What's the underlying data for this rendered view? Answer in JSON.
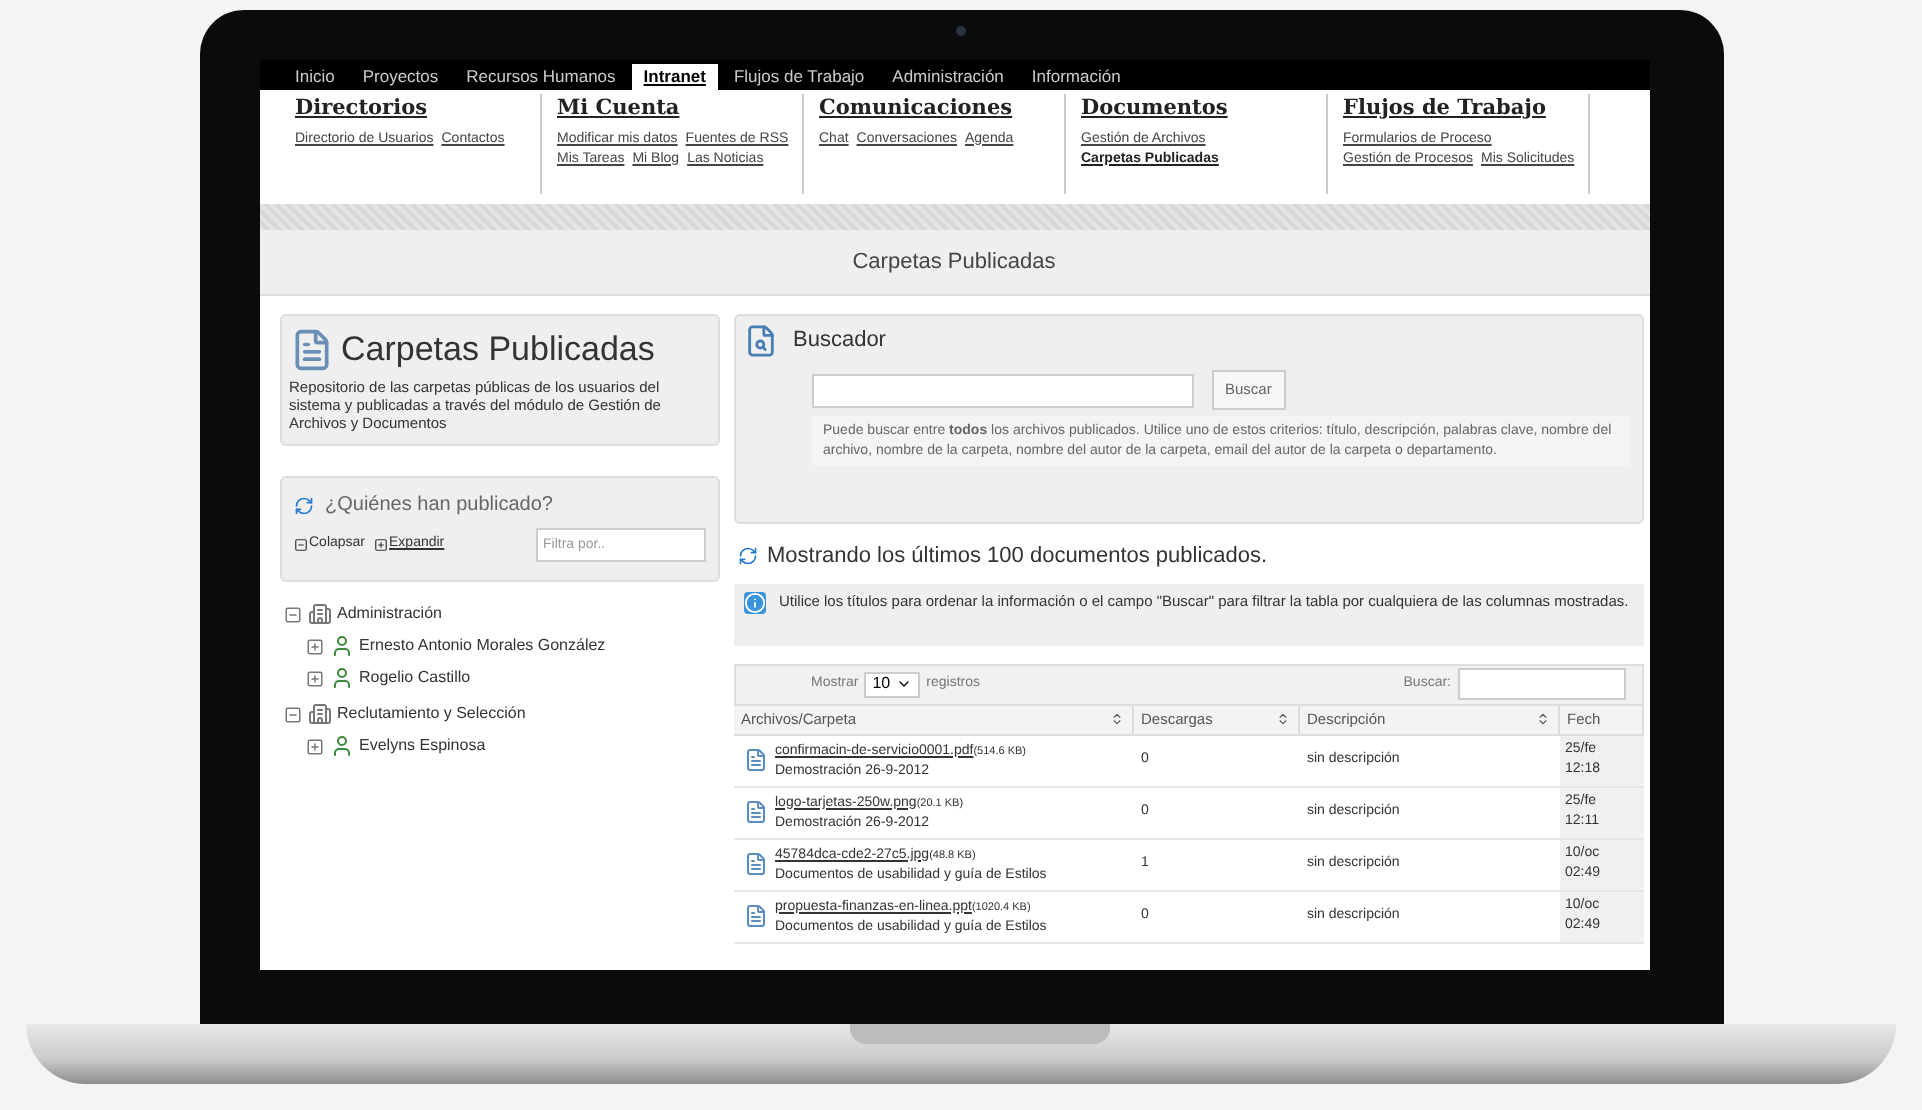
{
  "nav": [
    {
      "label": "Inicio",
      "selected": false
    },
    {
      "label": "Proyectos",
      "selected": false
    },
    {
      "label": "Recursos Humanos",
      "selected": false
    },
    {
      "label": "Intranet",
      "selected": true
    },
    {
      "label": "Flujos de Trabajo",
      "selected": false
    },
    {
      "label": "Administración",
      "selected": false
    },
    {
      "label": "Información",
      "selected": false
    }
  ],
  "menu": [
    {
      "title": "Directorios",
      "links": [
        {
          "label": "Directorio de Usuarios",
          "selected": false
        },
        {
          "label": "Contactos",
          "selected": false
        }
      ]
    },
    {
      "title": "Mi Cuenta",
      "links": [
        {
          "label": "Modificar mis datos",
          "selected": false
        },
        {
          "label": "Fuentes de RSS",
          "selected": false
        },
        {
          "label": "Mis Tareas",
          "selected": false
        },
        {
          "label": "Mi Blog",
          "selected": false
        },
        {
          "label": "Las Noticias",
          "selected": false
        }
      ]
    },
    {
      "title": "Comunicaciones",
      "links": [
        {
          "label": "Chat",
          "selected": false
        },
        {
          "label": "Conversaciones",
          "selected": false
        },
        {
          "label": "Agenda",
          "selected": false
        }
      ]
    },
    {
      "title": "Documentos",
      "links": [
        {
          "label": "Gestión de Archivos",
          "selected": false
        },
        {
          "label": "Carpetas Publicadas",
          "selected": true
        }
      ]
    },
    {
      "title": "Flujos de Trabajo",
      "links": [
        {
          "label": "Formularios de Proceso",
          "selected": false
        },
        {
          "label": "Gestión de Procesos",
          "selected": false
        },
        {
          "label": "Mis Solicitudes",
          "selected": false
        }
      ]
    }
  ],
  "page_title": "Carpetas Publicadas",
  "intro": {
    "title": "Carpetas Publicadas",
    "text": "Repositorio de las carpetas públicas de los usuarios del sistema y publicadas a través del módulo de Gestión de Archivos y Documentos"
  },
  "publishers": {
    "title": "¿Quiénes han publicado?",
    "collapse": "Colapsar",
    "expand": "Expandir",
    "filter_placeholder": "Filtra por..",
    "tree": [
      {
        "label": "Administración",
        "kind": "department",
        "expanded": true,
        "children": [
          {
            "label": "Ernesto Antonio Morales González",
            "kind": "user",
            "expanded": false
          },
          {
            "label": "Rogelio Castillo",
            "kind": "user",
            "expanded": false
          }
        ]
      },
      {
        "label": "Reclutamiento y Selección",
        "kind": "department",
        "expanded": true,
        "children": [
          {
            "label": "Evelyns Espinosa",
            "kind": "user",
            "expanded": false
          }
        ]
      }
    ]
  },
  "search": {
    "title": "Buscador",
    "button": "Buscar",
    "hint": "Puede buscar entre **todos** los archivos publicados. Utilice uno de estos criterios: título, descripción, palabras clave, nombre del archivo, nombre de la carpeta, nombre del autor de la carpeta, email del autor de la carpeta o departamento."
  },
  "listing": {
    "title": "Mostrando los últimos 100 documentos publicados.",
    "info": "Utilice los títulos para ordenar la información o el campo \"Buscar\" para filtrar la tabla por cualquiera de las columnas mostradas.",
    "show": "Mostrar",
    "page_size": "10",
    "records": "registros",
    "filter_label": "Buscar:",
    "columns": [
      "Archivos/Carpeta",
      "Descargas",
      "Descripción",
      "Fech"
    ],
    "rows": [
      {
        "file": "confirmacin-de-servicio0001.pdf",
        "size": "(514.6 KB)",
        "folder": "Demostración 26-9-2012",
        "downloads": "0",
        "description": "sin descripción",
        "date": "25/fe",
        "time": "12:18"
      },
      {
        "file": "logo-tarjetas-250w.png",
        "size": "(20.1 KB)",
        "folder": "Demostración 26-9-2012",
        "downloads": "0",
        "description": "sin descripción",
        "date": "25/fe",
        "time": "12:11"
      },
      {
        "file": "45784dca-cde2-27c5.jpg",
        "size": "(48.8 KB)",
        "folder": "Documentos de usabilidad y guía de Estilos",
        "downloads": "1",
        "description": "sin descripción",
        "date": "10/oc",
        "time": "02:49"
      },
      {
        "file": "propuesta-finanzas-en-linea.ppt",
        "size": "(1020.4 KB)",
        "folder": "Documentos de usabilidad y guía de Estilos",
        "downloads": "0",
        "description": "sin descripción",
        "date": "10/oc",
        "time": "02:49"
      }
    ]
  }
}
